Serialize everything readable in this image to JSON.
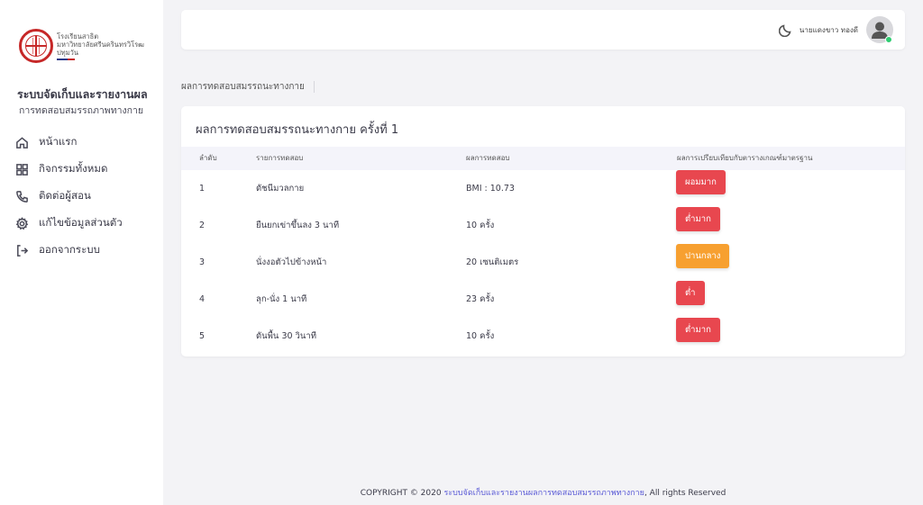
{
  "sidebar": {
    "logo_lines": [
      "โรงเรียนสาธิต",
      "มหาวิทยาลัยศรีนครินทรวิโรฒ",
      "ปทุมวัน"
    ],
    "app_title": "ระบบจัดเก็บและรายงานผล",
    "app_subtitle": "การทดสอบสมรรถภาพทางกาย",
    "items": [
      {
        "label": "หน้าแรก",
        "icon": "home-icon"
      },
      {
        "label": "กิจกรรมทั้งหมด",
        "icon": "grid-icon"
      },
      {
        "label": "ติดต่อผู้สอน",
        "icon": "phone-icon"
      },
      {
        "label": "แก้ไขข้อมูลส่วนตัว",
        "icon": "gear-icon"
      },
      {
        "label": "ออกจากระบบ",
        "icon": "logout-icon"
      }
    ]
  },
  "header": {
    "username": "นายแดงขาว ทองดี",
    "theme_icon": "moon-icon",
    "avatar_icon": "user-avatar-icon"
  },
  "breadcrumb": "ผลการทดสอบสมรรถนะทางกาย",
  "card": {
    "title": "ผลการทดสอบสมรรถนะทางกาย ครั้งที่ 1",
    "columns": [
      "ลำดับ",
      "รายการทดสอบ",
      "ผลการทดสอบ",
      "ผลการเปรียบเทียบกับตารางเกณฑ์มาตรฐาน"
    ],
    "rows": [
      {
        "no": "1",
        "test": "ดัชนีมวลกาย",
        "result": "BMI : 10.73",
        "rating": "ผอมมาก",
        "color": "#e8474f"
      },
      {
        "no": "2",
        "test": "ยืนยกเข่าขึ้นลง 3 นาที",
        "result": "10 ครั้ง",
        "rating": "ต่ำมาก",
        "color": "#e8474f"
      },
      {
        "no": "3",
        "test": "นั่งงอตัวไปข้างหน้า",
        "result": "20 เซนติเมตร",
        "rating": "ปานกลาง",
        "color": "#f7a030"
      },
      {
        "no": "4",
        "test": "ลุก-นั่ง 1 นาที",
        "result": "23 ครั้ง",
        "rating": "ต่ำ",
        "color": "#e8474f"
      },
      {
        "no": "5",
        "test": "ดันพื้น 30 วินาที",
        "result": "10 ครั้ง",
        "rating": "ต่ำมาก",
        "color": "#e8474f"
      }
    ]
  },
  "footer": {
    "prefix": "COPYRIGHT © 2020 ",
    "link": "ระบบจัดเก็บและรายงานผลการทดสอบสมรรถภาพทางกาย",
    "suffix": ", All rights Reserved"
  },
  "colors": {
    "accent": "#5a5ad6",
    "danger": "#e8474f",
    "warning": "#f7a030",
    "online": "#2ecc71"
  }
}
